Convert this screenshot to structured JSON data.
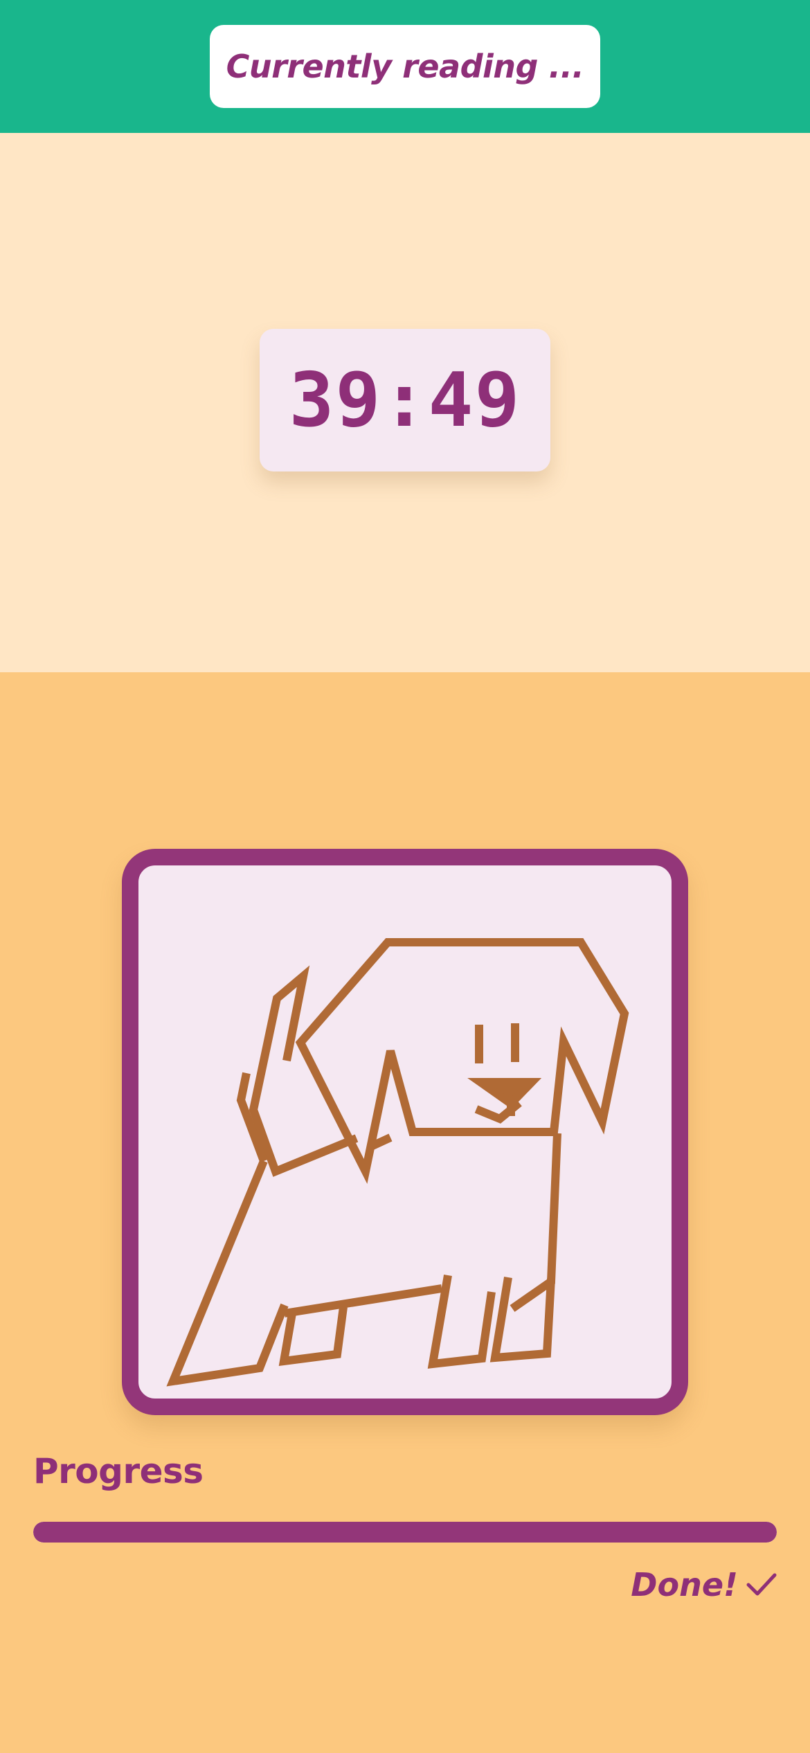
{
  "header": {
    "status_label": "Currently reading ..."
  },
  "timer": {
    "display": "39:49"
  },
  "reward": {
    "icon": "dog-icon"
  },
  "progress": {
    "label": "Progress",
    "value": 1.0,
    "done_label": "Done!",
    "done_icon": "checkmark-icon"
  },
  "colors": {
    "header_bg": "#19B68C",
    "timer_section_bg": "#FFE6C5",
    "reward_section_bg": "#FCC87F",
    "accent": "#933679",
    "card_bg": "#F5E8F2",
    "illustration": "#B06A35"
  }
}
